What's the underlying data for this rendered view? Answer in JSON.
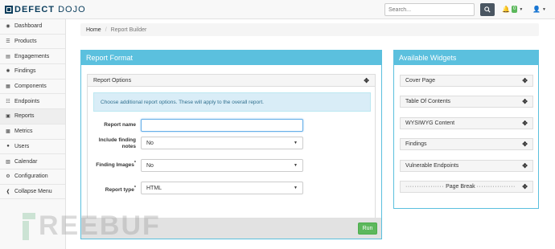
{
  "brand": {
    "part1": "DEFECT",
    "part2": "DOJO"
  },
  "header": {
    "search_placeholder": "Search...",
    "notification_count": "0"
  },
  "sidebar": {
    "items": [
      {
        "label": "Dashboard",
        "icon": "dashboard-icon"
      },
      {
        "label": "Products",
        "icon": "list-icon"
      },
      {
        "label": "Engagements",
        "icon": "inbox-icon"
      },
      {
        "label": "Findings",
        "icon": "bug-icon"
      },
      {
        "label": "Components",
        "icon": "grid-icon"
      },
      {
        "label": "Endpoints",
        "icon": "sitemap-icon"
      },
      {
        "label": "Reports",
        "icon": "file-icon"
      },
      {
        "label": "Metrics",
        "icon": "bar-chart-icon"
      },
      {
        "label": "Users",
        "icon": "user-icon"
      },
      {
        "label": "Calendar",
        "icon": "calendar-icon"
      },
      {
        "label": "Configuration",
        "icon": "gear-icon"
      },
      {
        "label": "Collapse Menu",
        "icon": "collapse-icon"
      }
    ]
  },
  "breadcrumb": {
    "home": "Home",
    "current": "Report Builder"
  },
  "report_format": {
    "title": "Report Format",
    "options_title": "Report Options",
    "info": "Choose additional report options. These will apply to the overall report.",
    "fields": {
      "report_name_label": "Report name",
      "report_name_value": "",
      "include_notes_label": "Include finding notes",
      "include_notes_value": "No",
      "finding_images_label": "Finding Images",
      "finding_images_value": "No",
      "report_type_label": "Report type",
      "report_type_value": "HTML",
      "required_mark": "*"
    },
    "run_label": "Run"
  },
  "widgets": {
    "title": "Available Widgets",
    "items": [
      "Cover Page",
      "Table Of Contents",
      "WYSIWYG Content",
      "Findings",
      "Vulnerable Endpoints"
    ],
    "page_break": "Page Break"
  },
  "watermark": "REEBUF"
}
